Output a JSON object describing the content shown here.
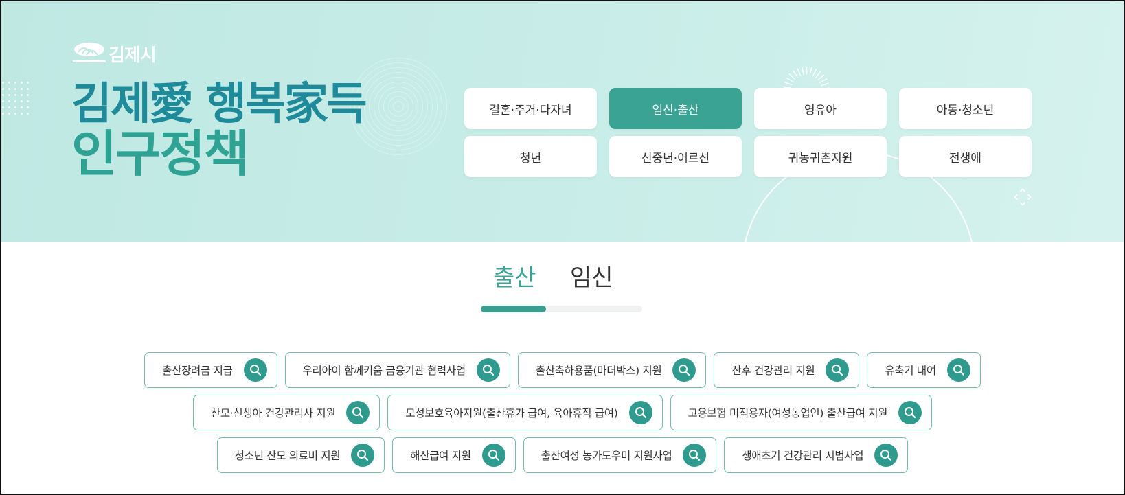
{
  "logo": {
    "text": "김제시"
  },
  "hero": {
    "title_line1": "김제愛 행복家득",
    "title_line2": "인구정책"
  },
  "categories": [
    {
      "label": "결혼·주거·다자녀",
      "active": false
    },
    {
      "label": "임신·출산",
      "active": true
    },
    {
      "label": "영유아",
      "active": false
    },
    {
      "label": "아동·청소년",
      "active": false
    },
    {
      "label": "청년",
      "active": false
    },
    {
      "label": "신중년·어르신",
      "active": false
    },
    {
      "label": "귀농귀촌지원",
      "active": false
    },
    {
      "label": "전생애",
      "active": false
    }
  ],
  "tabs": [
    {
      "label": "출산",
      "active": true
    },
    {
      "label": "임신",
      "active": false
    }
  ],
  "programs": [
    [
      {
        "label": "출산장려금 지급"
      },
      {
        "label": "우리아이 함께키움 금융기관 협력사업"
      },
      {
        "label": "출산축하용품(마더박스) 지원"
      },
      {
        "label": "산후 건강관리 지원"
      },
      {
        "label": "유축기 대여"
      }
    ],
    [
      {
        "label": "산모·신생아 건강관리사 지원"
      },
      {
        "label": "모성보호육아지원(출산휴가 급여, 육아휴직 급여)"
      },
      {
        "label": "고용보험 미적용자(여성농업인) 출산급여 지원"
      }
    ],
    [
      {
        "label": "청소년 산모 의료비 지원"
      },
      {
        "label": "해산급여 지원"
      },
      {
        "label": "출산여성 농가도우미 지원사업"
      },
      {
        "label": "생애초기 건강관리 시범사업"
      }
    ]
  ],
  "colors": {
    "primary": "#3aa394",
    "title_blue": "#1f8a99",
    "title_green": "#2ea394",
    "hero_bg": "#c4ebe6",
    "pill_border": "#6fbdb1"
  },
  "icons": {
    "pill_icon": "search-icon",
    "logo_icon": "logo-mark-icon"
  }
}
